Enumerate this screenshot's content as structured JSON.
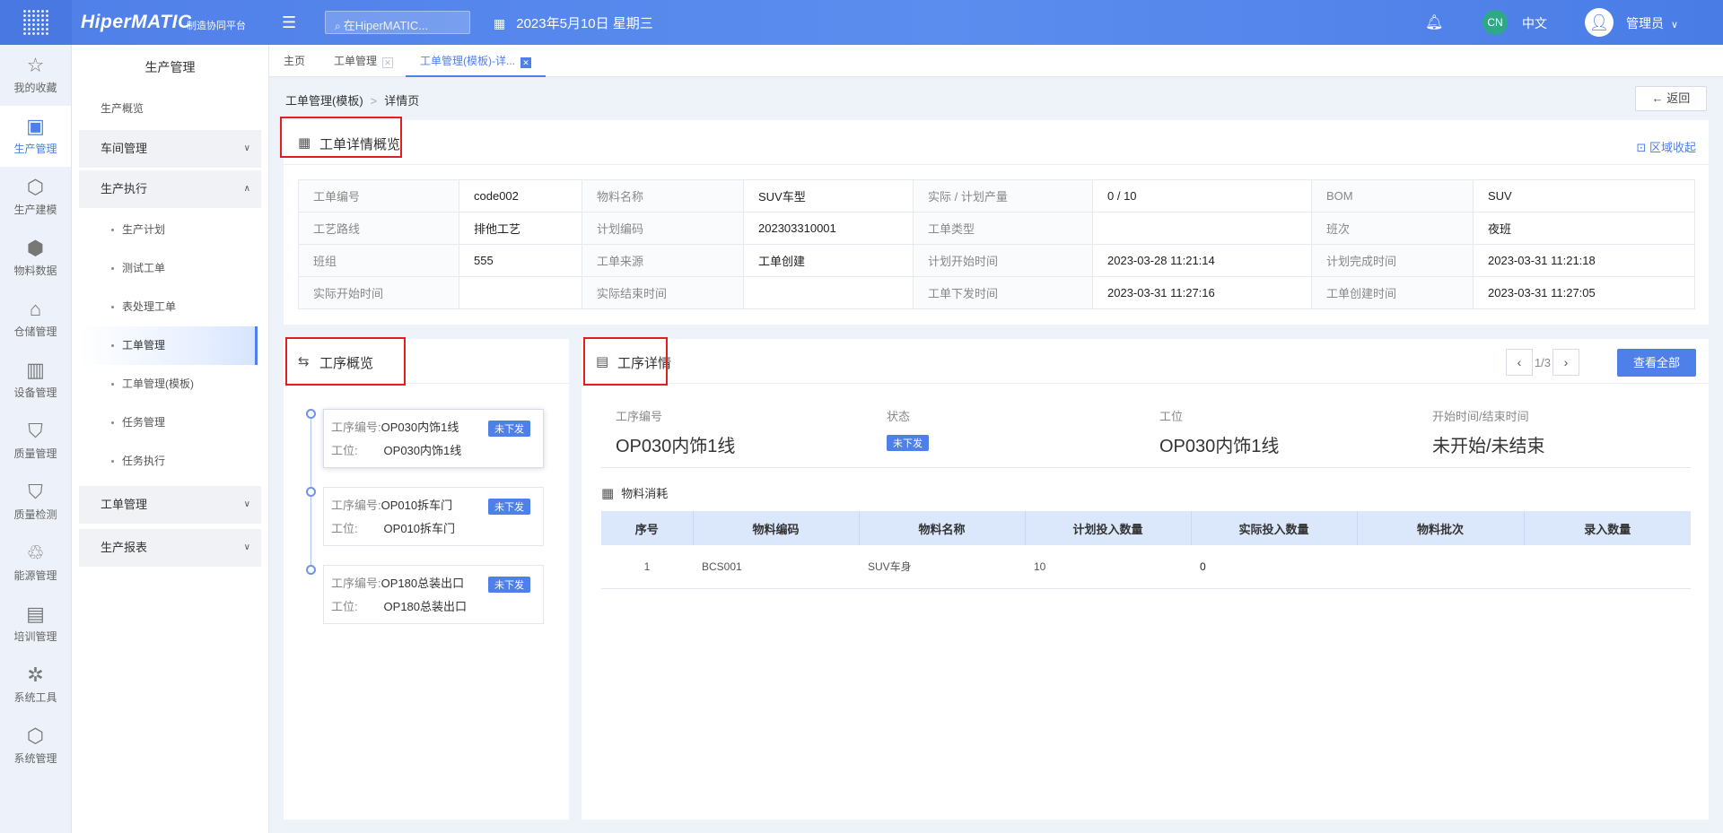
{
  "header": {
    "brand": "HiperMATIC",
    "brand_sub": "制造协同平台",
    "search_placeholder": "在HiperMATIC...",
    "date": "2023年5月10日 星期三",
    "lang_badge": "CN",
    "lang": "中文",
    "user": "管理员"
  },
  "rail": [
    {
      "label": "我的收藏",
      "icon": "star-icon",
      "glyph": "☆"
    },
    {
      "label": "生产管理",
      "icon": "production-icon",
      "glyph": "▣"
    },
    {
      "label": "生产建模",
      "icon": "cube-icon",
      "glyph": "⬡"
    },
    {
      "label": "物料数据",
      "icon": "box-icon",
      "glyph": "⬢"
    },
    {
      "label": "仓储管理",
      "icon": "warehouse-icon",
      "glyph": "⌂"
    },
    {
      "label": "设备管理",
      "icon": "device-icon",
      "glyph": "▥"
    },
    {
      "label": "质量管理",
      "icon": "shield-icon",
      "glyph": "⛉"
    },
    {
      "label": "质量检测",
      "icon": "shield-check-icon",
      "glyph": "⛉"
    },
    {
      "label": "能源管理",
      "icon": "recycle-icon",
      "glyph": "♲"
    },
    {
      "label": "培训管理",
      "icon": "training-icon",
      "glyph": "▤"
    },
    {
      "label": "系统工具",
      "icon": "network-icon",
      "glyph": "✲"
    },
    {
      "label": "系统管理",
      "icon": "settings-cube-icon",
      "glyph": "⬡"
    }
  ],
  "sidemenu": {
    "title": "生产管理",
    "overview": "生产概览",
    "workshop": "车间管理",
    "exec": "生产执行",
    "subs": [
      "生产计划",
      "测试工单",
      "表处理工单",
      "工单管理",
      "工单管理(模板)",
      "任务管理",
      "任务执行"
    ],
    "workorder": "工单管理",
    "report": "生产报表"
  },
  "tabs": {
    "home": "主页",
    "t1": "工单管理",
    "t2": "工单管理(模板)-详..."
  },
  "breadcrumb": {
    "parent": "工单管理(模板)",
    "sep": ">",
    "current": "详情页"
  },
  "back_label": "返回",
  "overview": {
    "title": "工单详情概览",
    "collapse": "区域收起",
    "rows": [
      [
        {
          "label": "工单编号",
          "value": "code002"
        },
        {
          "label": "物料名称",
          "value": "SUV车型"
        },
        {
          "label": "实际 / 计划产量",
          "value": "0 / 10"
        },
        {
          "label": "BOM",
          "value": "SUV"
        }
      ],
      [
        {
          "label": "工艺路线",
          "value": "排他工艺"
        },
        {
          "label": "计划编码",
          "value": "202303310001"
        },
        {
          "label": "工单类型",
          "value": ""
        },
        {
          "label": "班次",
          "value": "夜班"
        }
      ],
      [
        {
          "label": "班组",
          "value": "555"
        },
        {
          "label": "工单来源",
          "value": "工单创建"
        },
        {
          "label": "计划开始时间",
          "value": "2023-03-28 11:21:14"
        },
        {
          "label": "计划完成时间",
          "value": "2023-03-31 11:21:18"
        }
      ],
      [
        {
          "label": "实际开始时间",
          "value": ""
        },
        {
          "label": "实际结束时间",
          "value": ""
        },
        {
          "label": "工单下发时间",
          "value": "2023-03-31 11:27:16"
        },
        {
          "label": "工单创建时间",
          "value": "2023-03-31 11:27:05"
        }
      ]
    ]
  },
  "process_overview": {
    "title": "工序概览",
    "code_label": "工序编号:",
    "station_label": "工位:",
    "items": [
      {
        "code": "OP030内饰1线",
        "station": "OP030内饰1线",
        "status": "未下发"
      },
      {
        "code": "OP010拆车门",
        "station": "OP010拆车门",
        "status": "未下发"
      },
      {
        "code": "OP180总装出口",
        "station": "OP180总装出口",
        "status": "未下发"
      }
    ]
  },
  "process_detail": {
    "title": "工序详情",
    "pager": "1/3",
    "view_all": "查看全部",
    "code_label": "工序编号",
    "code": "OP030内饰1线",
    "status_label": "状态",
    "status": "未下发",
    "station_label": "工位",
    "station": "OP030内饰1线",
    "time_label": "开始时间/结束时间",
    "time": "未开始/未结束",
    "material_title": "物料消耗",
    "columns": [
      "序号",
      "物料编码",
      "物料名称",
      "计划投入数量",
      "实际投入数量",
      "物料批次",
      "录入数量"
    ],
    "rows": [
      [
        "1",
        "BCS001",
        "SUV车身",
        "10",
        "0",
        "",
        ""
      ]
    ]
  },
  "colors": {
    "accent": "#4f7fe8",
    "highlight_border": "#e02020",
    "table_head": "#dbe7fb"
  }
}
